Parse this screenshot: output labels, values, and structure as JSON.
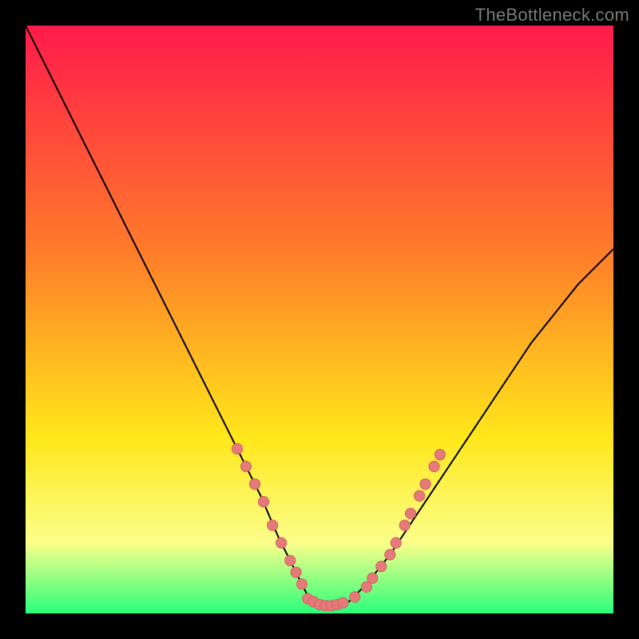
{
  "attribution": "TheBottleneck.com",
  "colors": {
    "frame": "#000000",
    "gradient_top": "#ff1a4b",
    "gradient_mid1": "#ff7b2a",
    "gradient_mid2": "#ffe71a",
    "gradient_mid3": "#fbff8a",
    "gradient_bottom": "#2aff7a",
    "curve": "#000000",
    "dot_fill": "#e47a79",
    "dot_stroke": "#d46261"
  },
  "chart_data": {
    "type": "line",
    "title": "",
    "xlabel": "",
    "ylabel": "",
    "xlim": [
      0,
      100
    ],
    "ylim": [
      0,
      100
    ],
    "series": [
      {
        "name": "bottleneck-curve",
        "x": [
          0,
          4,
          8,
          12,
          16,
          20,
          24,
          28,
          32,
          36,
          40,
          43,
          46,
          48,
          50,
          52,
          55,
          58,
          62,
          66,
          70,
          74,
          78,
          82,
          86,
          90,
          94,
          98,
          100
        ],
        "y": [
          100,
          92,
          84,
          76,
          68,
          60,
          52,
          44,
          36,
          28,
          20,
          13,
          7,
          3,
          1,
          1,
          2,
          5,
          10,
          16,
          22,
          28,
          34,
          40,
          46,
          51,
          56,
          60,
          62
        ]
      }
    ],
    "dots": [
      {
        "name": "left-dot-1",
        "x": 36.0,
        "y": 28.0
      },
      {
        "name": "left-dot-2",
        "x": 37.5,
        "y": 25.0
      },
      {
        "name": "left-dot-3",
        "x": 39.0,
        "y": 22.0
      },
      {
        "name": "left-dot-4",
        "x": 40.5,
        "y": 19.0
      },
      {
        "name": "left-dot-5",
        "x": 42.0,
        "y": 15.0
      },
      {
        "name": "left-dot-6",
        "x": 43.5,
        "y": 12.0
      },
      {
        "name": "left-dot-7",
        "x": 45.0,
        "y": 9.0
      },
      {
        "name": "left-dot-8",
        "x": 46.0,
        "y": 7.0
      },
      {
        "name": "left-dot-9",
        "x": 47.0,
        "y": 5.0
      },
      {
        "name": "bottom-dot-1",
        "x": 48.0,
        "y": 2.5
      },
      {
        "name": "bottom-dot-2",
        "x": 49.0,
        "y": 2.0
      },
      {
        "name": "bottom-dot-3",
        "x": 50.0,
        "y": 1.5
      },
      {
        "name": "bottom-dot-4",
        "x": 51.0,
        "y": 1.3
      },
      {
        "name": "bottom-dot-5",
        "x": 52.0,
        "y": 1.3
      },
      {
        "name": "bottom-dot-6",
        "x": 53.0,
        "y": 1.5
      },
      {
        "name": "bottom-dot-7",
        "x": 54.0,
        "y": 1.8
      },
      {
        "name": "bottom-dot-8",
        "x": 56.0,
        "y": 2.8
      },
      {
        "name": "bottom-dot-9",
        "x": 58.0,
        "y": 4.5
      },
      {
        "name": "right-dot-1",
        "x": 59.0,
        "y": 6.0
      },
      {
        "name": "right-dot-2",
        "x": 60.5,
        "y": 8.0
      },
      {
        "name": "right-dot-3",
        "x": 62.0,
        "y": 10.0
      },
      {
        "name": "right-dot-4",
        "x": 63.0,
        "y": 12.0
      },
      {
        "name": "right-dot-5",
        "x": 64.5,
        "y": 15.0
      },
      {
        "name": "right-dot-6",
        "x": 65.5,
        "y": 17.0
      },
      {
        "name": "right-dot-7",
        "x": 67.0,
        "y": 20.0
      },
      {
        "name": "right-dot-8",
        "x": 68.0,
        "y": 22.0
      },
      {
        "name": "right-dot-9",
        "x": 69.5,
        "y": 25.0
      },
      {
        "name": "right-dot-10",
        "x": 70.5,
        "y": 27.0
      }
    ],
    "dot_radius": 0.9
  }
}
